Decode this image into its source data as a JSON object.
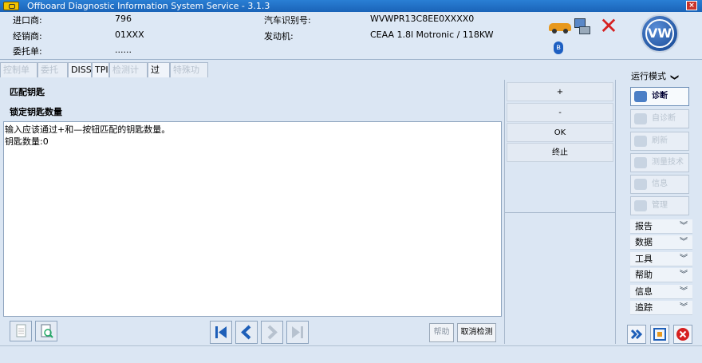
{
  "window": {
    "title": "Offboard Diagnostic Information System Service - 3.1.3",
    "close_label": "×"
  },
  "header": {
    "importer_label": "进口商:",
    "importer_value": "796",
    "dealer_label": "经销商:",
    "dealer_value": "01XXX",
    "order_label": "委托单:",
    "order_value": "......",
    "vin_label": "汽车识别号:",
    "vin_value": "WVWPR13C8EE0XXXX0",
    "engine_label": "发动机:",
    "engine_value": "CEAA 1.8l Motronic / 118KW",
    "logo_text": "VW",
    "bluetooth_glyph": "ʙ"
  },
  "tabs": [
    {
      "label": "控制单元",
      "enabled": false
    },
    {
      "label": "委托单",
      "enabled": false
    },
    {
      "label": "DISS",
      "enabled": true
    },
    {
      "label": "TPI",
      "enabled": true
    },
    {
      "label": "检测计划",
      "enabled": false
    },
    {
      "label": "过程",
      "enabled": true
    },
    {
      "label": "特殊功能",
      "enabled": false
    }
  ],
  "main": {
    "heading": "匹配钥匙",
    "subheading": "锁定钥匙数量",
    "lines": [
      "输入应该通过+和—按钮匹配的钥匙数量。",
      "钥匙数量:0"
    ],
    "help_label": "帮助",
    "cancel_label": "取消检测"
  },
  "keypad": {
    "plus": "+",
    "minus": "-",
    "ok": "OK",
    "stop": "终止"
  },
  "sidebar": {
    "mode_label": "运行模式",
    "buttons": [
      {
        "label": "诊断",
        "active": true
      },
      {
        "label": "自诊断",
        "active": false
      },
      {
        "label": "刷新",
        "active": false
      },
      {
        "label": "测量技术",
        "active": false
      },
      {
        "label": "信息",
        "active": false
      },
      {
        "label": "管理",
        "active": false
      }
    ],
    "menus": [
      {
        "label": "报告"
      },
      {
        "label": "数据"
      },
      {
        "label": "工具"
      },
      {
        "label": "帮助"
      },
      {
        "label": "信息"
      },
      {
        "label": "追踪"
      }
    ],
    "chevron": "❯"
  },
  "colors": {
    "accent": "#1a63b8",
    "background": "#dbe6f3",
    "nav_blue": "#1e5fb8",
    "close_red": "#d62020"
  }
}
